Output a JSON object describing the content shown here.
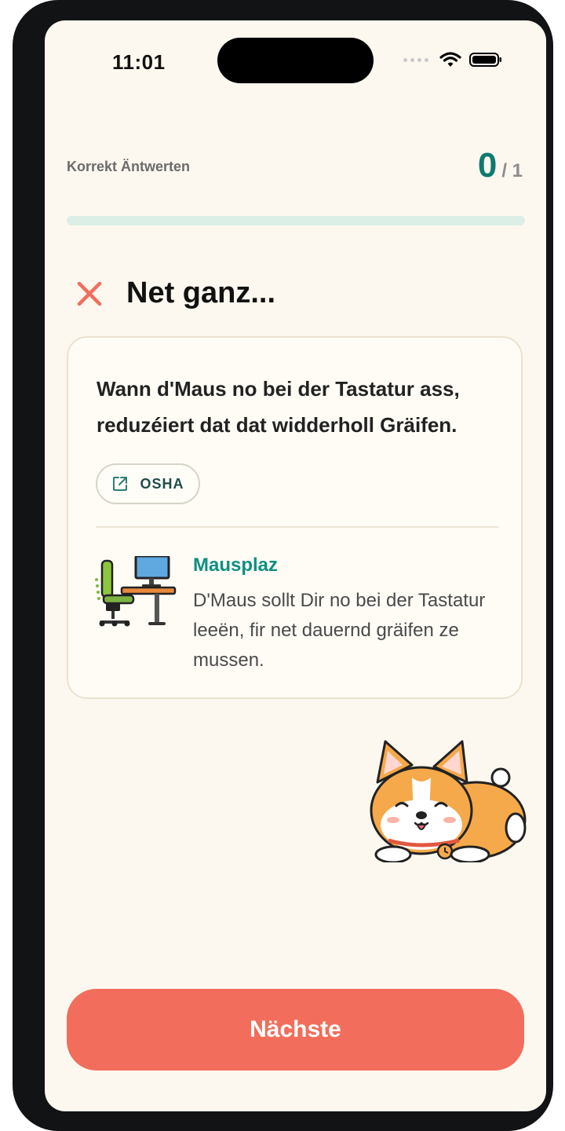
{
  "status_bar": {
    "time": "11:01"
  },
  "progress": {
    "label": "Korrekt Äntwerten",
    "correct": "0",
    "total": "/ 1",
    "fill_fraction": 0
  },
  "result": {
    "title": "Net ganz..."
  },
  "card": {
    "statement": "Wann d'Maus no bei der Tastatur ass, reduzéiert dat dat widderholl Gräifen.",
    "source_label": "OSHA",
    "tip": {
      "title": "Mausplaz",
      "text": "D'Maus sollt Dir no bei der Tastatur leeën, fir net dauernd gräifen ze mussen."
    }
  },
  "footer": {
    "next_label": "Nächste"
  },
  "colors": {
    "accent": "#0f7a6f",
    "error": "#f26d5b",
    "background": "#fdf8ef"
  }
}
